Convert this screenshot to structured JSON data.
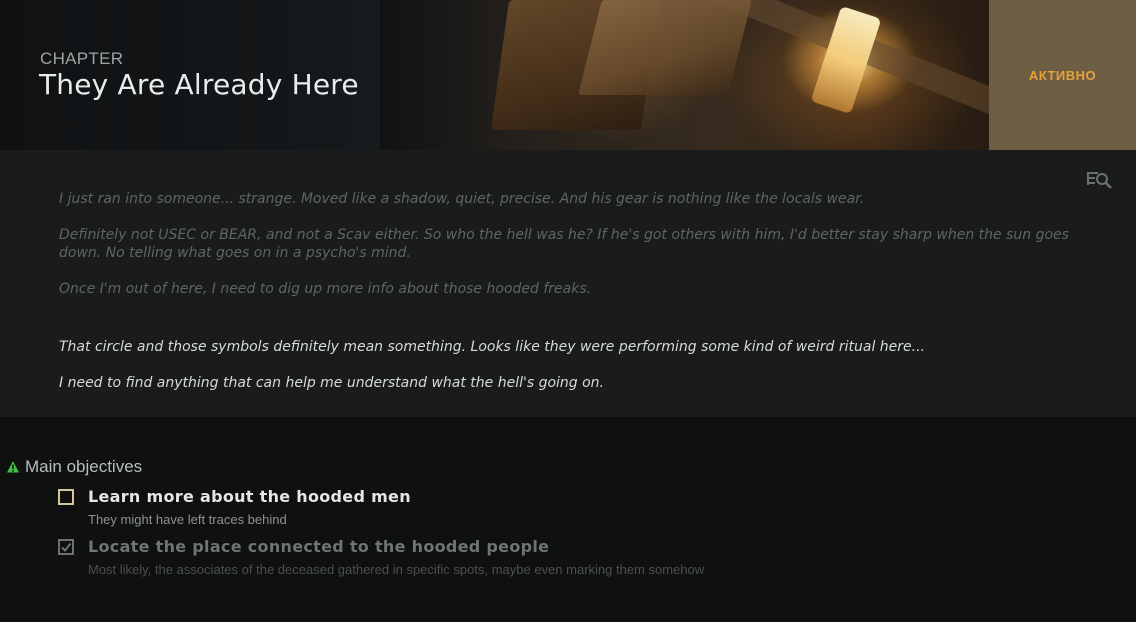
{
  "header": {
    "chapter_label": "CHAPTER",
    "title": "They Are Already Here",
    "status": "АКТИВНО"
  },
  "description": {
    "paragraphs_dim": [
      "I just ran into someone... strange. Moved like a shadow, quiet, precise. And his gear is nothing like the locals wear.",
      "Definitely not USEC or BEAR, and not a Scav either. So who the hell was he? If he's got others with him, I'd better stay sharp when the sun goes down. No telling what goes on in a psycho's mind.",
      "Once I'm out of here, I need to dig up more info about those hooded freaks."
    ],
    "paragraphs_bright": [
      "That circle and those symbols definitely mean something. Looks like they were performing some kind of weird ritual here...",
      "I need to find anything that can help me understand what the hell's going on."
    ],
    "icon": "lore-search-icon"
  },
  "objectives": {
    "header": "Main objectives",
    "header_icon": "warning-icon",
    "items": [
      {
        "title": "Learn more about the hooded men",
        "description": "They might have left traces behind",
        "completed": false
      },
      {
        "title": "Locate the place connected to the hooded people",
        "description": "Most likely, the associates of the deceased gathered in specific spots, maybe even marking them somehow",
        "completed": true
      }
    ]
  },
  "colors": {
    "status_bg": "#6d5e44",
    "status_text": "#e6a23a",
    "objective_icon": "#3fbf3f"
  }
}
